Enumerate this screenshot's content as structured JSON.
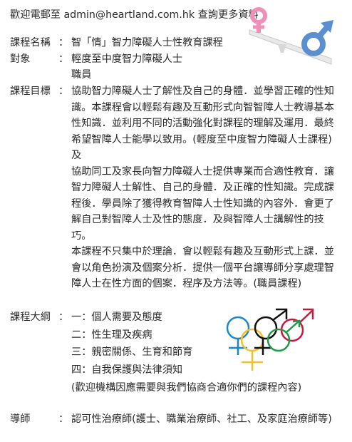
{
  "header": {
    "contact_line": "歡迎電郵至 admin@heartland.com.hk 查詢更多資料"
  },
  "colon": "：",
  "course_name": {
    "label": "課程名稱",
    "value": "智「情」智力障礙人士性教育課程"
  },
  "audience": {
    "label": "對象",
    "values": [
      "輕度至中度智力障礙人士",
      "職員"
    ]
  },
  "objectives": {
    "label": "課程目標",
    "lines": [
      "協助智力障礙人士了解性及自己的身體．並學習正確的性知",
      "識。本課程會以輕鬆有趣及互動形式向智智障人士教導基本",
      "性知識．並利用不同的活動強化對課程的理解及運用．最終",
      "希望智障人士能學以致用。(輕度至中度智力障礙人士課程)",
      "及",
      "協助同工及家長向智力障礙人士提供專業而合適性教育．讓",
      "智力障礙人士解性、自己的身體．及正確的性知識。完成課",
      "程後．學員除了獲得教育智障人士性知識的內容外．會更了",
      "解自己對智障人士及性的態度．及與智障人士講解性的技",
      "巧。",
      "本課程不只集中於理論．會以輕鬆有趣及互動形式上課．並",
      "會以角色扮演及個案分析．提供一個平台讓導師分享處理智",
      "障人士在性方面的個案．程序及方法等。(職員課程)"
    ]
  },
  "outline": {
    "label": "課程大綱",
    "items": [
      "一：個人需要及態度",
      "二：性生理及疾病",
      "三：親密關係、生育和節育",
      "四：自我保護與法律須知"
    ],
    "note": "(歡迎機構因應需要與我們協商合適你們的課程內容)"
  },
  "instructor": {
    "label": "導師",
    "value": "認可性治療師(護士、職業治療師、社工、及家庭治療師等)"
  },
  "colors": {
    "female_pink": "#f08fb8",
    "male_blue": "#5b8fd0",
    "ring_blue": "#1a87c6",
    "ring_yellow": "#f2c12e",
    "ring_black": "#111111",
    "ring_green": "#1e9a4a",
    "ring_red": "#c8193c"
  }
}
